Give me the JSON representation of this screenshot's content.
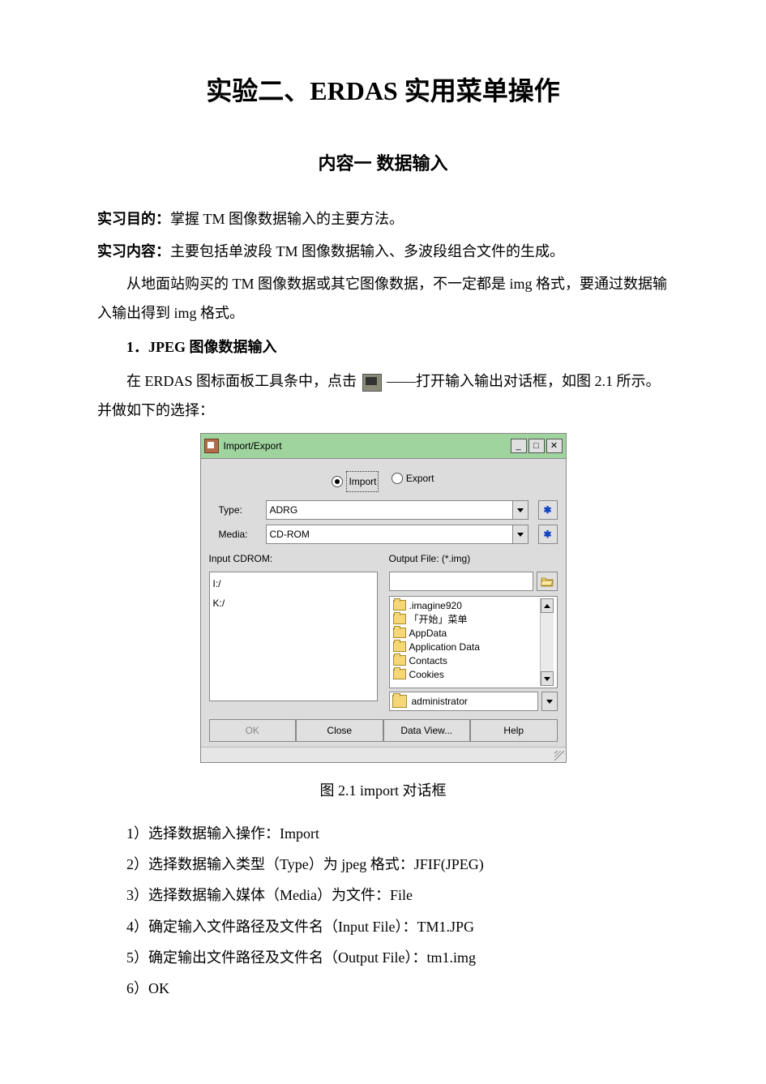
{
  "doc": {
    "title": "实验二、ERDAS 实用菜单操作",
    "subtitle": "内容一  数据输入",
    "purpose_label": "实习目的：",
    "purpose_text": "掌握 TM 图像数据输入的主要方法。",
    "content_label": "实习内容：",
    "content_text": "主要包括单波段 TM 图像数据输入、多波段组合文件的生成。",
    "intro1": "从地面站购买的 TM 图像数据或其它图像数据，不一定都是 img 格式，要通过数据输入输出得到 img 格式。",
    "section1": "1．JPEG 图像数据输入",
    "intro2a": "在 ERDAS 图标面板工具条中，点击",
    "intro2b": "——打开输入输出对话框，如图 2.1 所示。并做如下的选择：",
    "caption": "图 2.1 import 对话框",
    "steps": [
      "1）选择数据输入操作：Import",
      "2）选择数据输入类型（Type）为 jpeg 格式：JFIF(JPEG)",
      "3）选择数据输入媒体（Media）为文件：File",
      "4）确定输入文件路径及文件名（Input File）：TM1.JPG",
      "5）确定输出文件路径及文件名（Output File）：tm1.img",
      "6）OK"
    ]
  },
  "dialog": {
    "title": "Import/Export",
    "radio_import": "Import",
    "radio_export": "Export",
    "type_label": "Type:",
    "type_value": "ADRG",
    "media_label": "Media:",
    "media_value": "CD-ROM",
    "input_label": "Input CDROM:",
    "output_label": "Output File: (*.img)",
    "drives": [
      "I:/",
      "K:/"
    ],
    "folders": [
      ".imagine920",
      "「开始」菜单",
      "AppData",
      "Application Data",
      "Contacts",
      "Cookies"
    ],
    "path_value": "administrator",
    "btn_ok": "OK",
    "btn_close": "Close",
    "btn_dataview": "Data View...",
    "btn_help": "Help",
    "win_min": "_",
    "win_max": "□",
    "win_close": "✕",
    "star": "✱"
  }
}
